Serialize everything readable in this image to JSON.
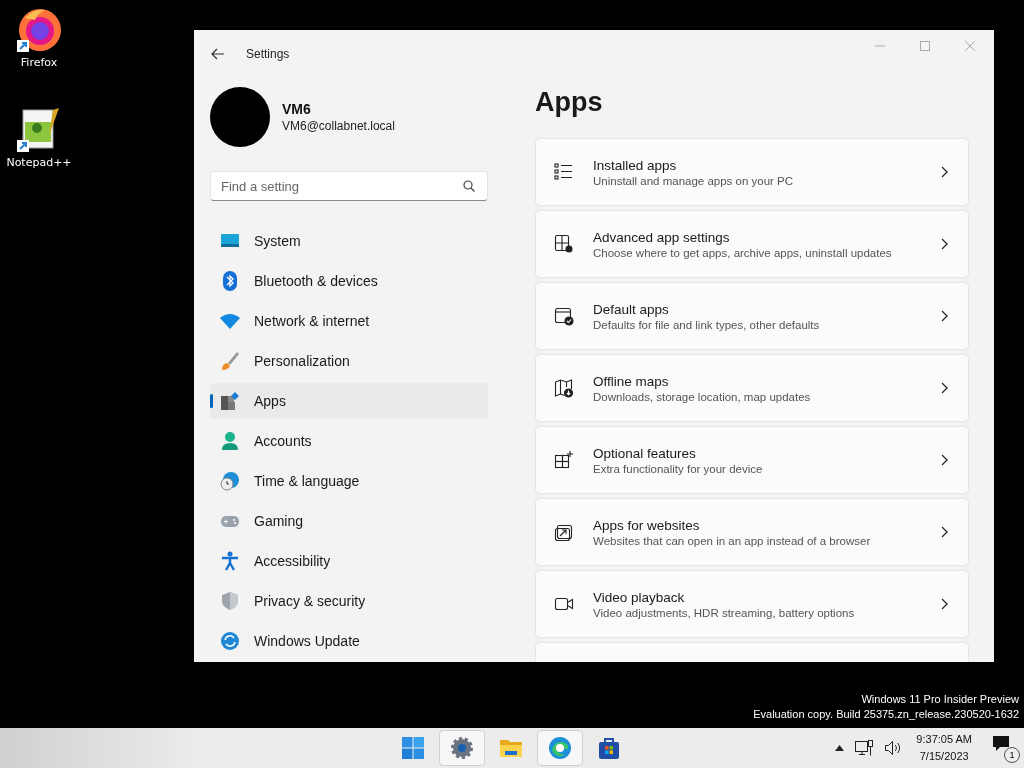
{
  "desktop_icons": [
    {
      "label": "Firefox"
    },
    {
      "label": "Notepad++"
    }
  ],
  "window": {
    "title": "Settings",
    "profile": {
      "name": "VM6",
      "email": "VM6@collabnet.local"
    },
    "search": {
      "placeholder": "Find a setting"
    },
    "nav": [
      {
        "label": "System",
        "selected": false
      },
      {
        "label": "Bluetooth & devices",
        "selected": false
      },
      {
        "label": "Network & internet",
        "selected": false
      },
      {
        "label": "Personalization",
        "selected": false
      },
      {
        "label": "Apps",
        "selected": true
      },
      {
        "label": "Accounts",
        "selected": false
      },
      {
        "label": "Time & language",
        "selected": false
      },
      {
        "label": "Gaming",
        "selected": false
      },
      {
        "label": "Accessibility",
        "selected": false
      },
      {
        "label": "Privacy & security",
        "selected": false
      },
      {
        "label": "Windows Update",
        "selected": false
      }
    ],
    "heading": "Apps",
    "cards": [
      {
        "title": "Installed apps",
        "subtitle": "Uninstall and manage apps on your PC"
      },
      {
        "title": "Advanced app settings",
        "subtitle": "Choose where to get apps, archive apps, uninstall updates"
      },
      {
        "title": "Default apps",
        "subtitle": "Defaults for file and link types, other defaults"
      },
      {
        "title": "Offline maps",
        "subtitle": "Downloads, storage location, map updates"
      },
      {
        "title": "Optional features",
        "subtitle": "Extra functionality for your device"
      },
      {
        "title": "Apps for websites",
        "subtitle": "Websites that can open in an app instead of a browser"
      },
      {
        "title": "Video playback",
        "subtitle": "Video adjustments, HDR streaming, battery options"
      }
    ]
  },
  "watermark": [
    "Windows 11 Pro Insider Preview",
    "Evaluation copy. Build 25375.zn_release.230520-1632"
  ],
  "taskbar": {
    "apps": [
      {
        "active": false
      },
      {
        "active": true
      },
      {
        "active": false
      },
      {
        "active": true
      },
      {
        "active": false
      }
    ],
    "time": "9:37:05 AM",
    "date": "7/15/2023",
    "notifications": "1"
  }
}
